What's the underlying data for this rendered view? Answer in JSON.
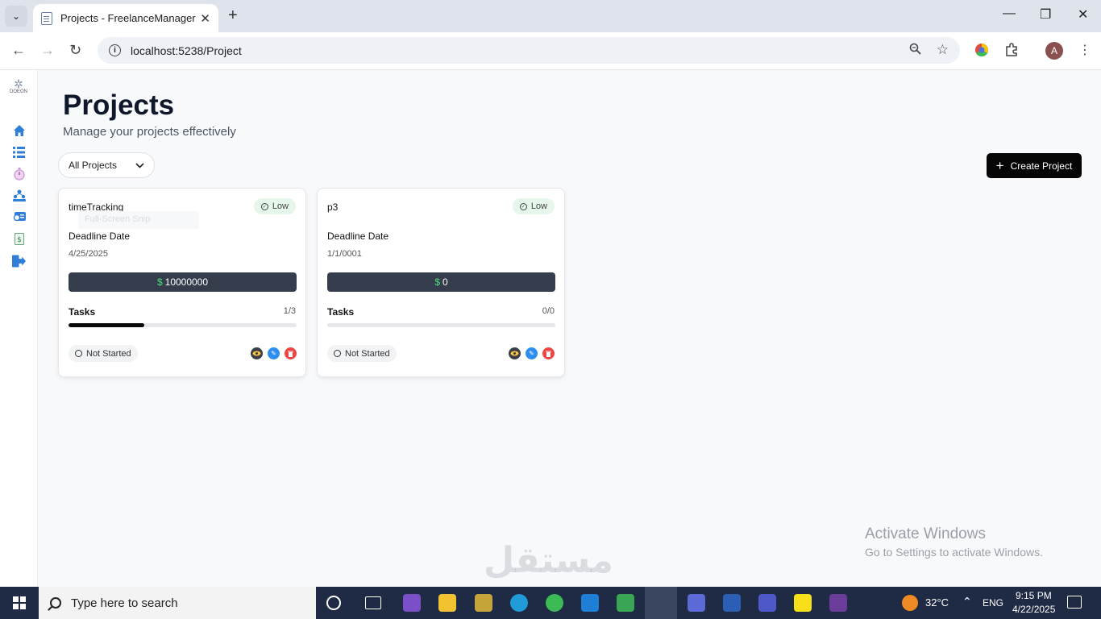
{
  "browser": {
    "tab_title": "Projects - FreelanceManager",
    "url": "localhost:5238/Project",
    "profile_initial": "A"
  },
  "sidebar": {
    "logo_text": "DOEON"
  },
  "page": {
    "title": "Projects",
    "subtitle": "Manage your projects effectively",
    "filter_value": "All Projects",
    "create_label": "Create Project"
  },
  "projects": [
    {
      "name": "timeTracking",
      "ghost_text": "Full-Screen Snip",
      "priority": "Low",
      "deadline_label": "Deadline Date",
      "deadline": "4/25/2025",
      "currency": "$",
      "budget": "10000000",
      "tasks_label": "Tasks",
      "tasks_count": "1/3",
      "progress": 0.333,
      "status": "Not Started"
    },
    {
      "name": "p3",
      "priority": "Low",
      "deadline_label": "Deadline Date",
      "deadline": "1/1/0001",
      "currency": "$",
      "budget": "0",
      "tasks_label": "Tasks",
      "tasks_count": "0/0",
      "progress": 0,
      "status": "Not Started"
    }
  ],
  "watermark": {
    "activate_title": "Activate Windows",
    "activate_sub": "Go to Settings to activate Windows.",
    "site_mark": "مستقل"
  },
  "taskbar": {
    "search_placeholder": "Type here to search",
    "temperature": "32°C",
    "language": "ENG",
    "time": "9:15 PM",
    "date": "4/22/2025"
  },
  "colors": {
    "accent": "#050505",
    "priority_bg": "#e6f6ea",
    "budget_bg": "#353d4c",
    "currency": "#4ade80",
    "view": "#3b3f46",
    "edit": "#2b8ef0",
    "delete": "#ef4444",
    "sidebar_icon": "#2f7fd8"
  }
}
